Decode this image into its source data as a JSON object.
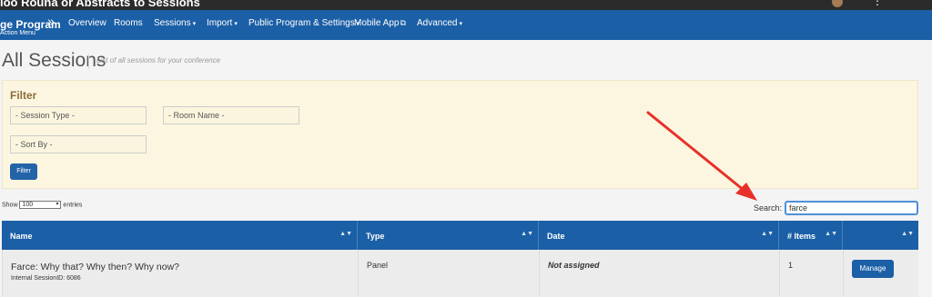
{
  "header": {
    "title_fragment": "ioo Rouna or Abstracts to Sessions"
  },
  "nav": {
    "brand": "ge Program",
    "brand_sub": "Action Menu",
    "items": [
      {
        "label": "Overview"
      },
      {
        "label": "Rooms"
      },
      {
        "label": "Sessions"
      },
      {
        "label": "Import"
      },
      {
        "label": "Public Program & Settings"
      },
      {
        "label": "Mobile App"
      },
      {
        "label": "Advanced"
      }
    ]
  },
  "page": {
    "title": "All Sessions",
    "subtitle": "List of all sessions for your conference"
  },
  "filter": {
    "title": "Filter",
    "session_type": "- Session Type -",
    "room_name": "- Room Name -",
    "sort_by": "- Sort By -",
    "button": "Filter"
  },
  "entries": {
    "show_label": "Show",
    "value": "100",
    "suffix": "entries"
  },
  "search": {
    "label": "Search:",
    "value": "farce"
  },
  "table": {
    "columns": [
      "Name",
      "Type",
      "Date",
      "# Items",
      ""
    ],
    "rows": [
      {
        "name": "Farce: Why that? Why then? Why now?",
        "internal_id": "Internal SessionID: 6086",
        "type": "Panel",
        "date": "Not assigned",
        "items": "1",
        "action": "Manage"
      }
    ]
  },
  "colors": {
    "nav_blue": "#1b5fa6",
    "filter_bg": "#fcf6e0",
    "annotation_arrow": "#e8302a"
  }
}
